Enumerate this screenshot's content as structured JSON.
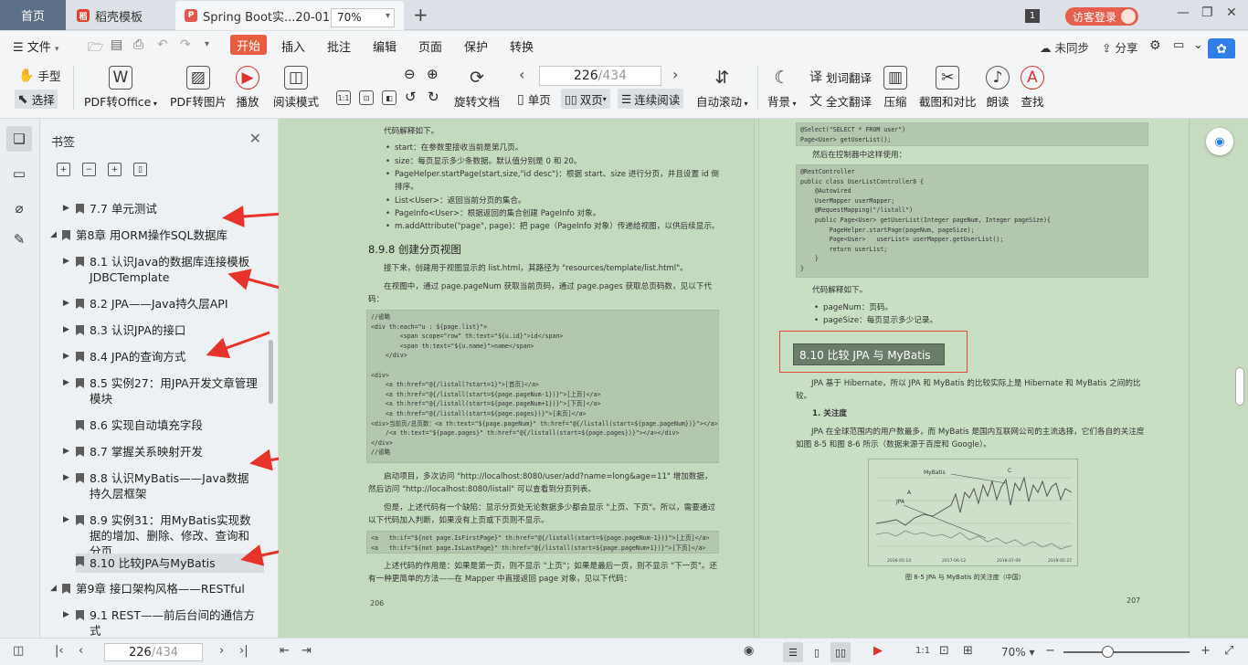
{
  "tabs": {
    "home": "首页",
    "template": "稻壳模板",
    "document": "Spring Boot实...20-01-01.pdf"
  },
  "titlebar": {
    "badge": "1",
    "login": "访客登录"
  },
  "menu": {
    "file": "文件",
    "items": [
      "开始",
      "插入",
      "批注",
      "编辑",
      "页面",
      "保护",
      "转换"
    ],
    "sync": "未同步",
    "share": "分享"
  },
  "toolbar": {
    "hand": "手型",
    "select": "选择",
    "pdf_to_office": "PDF转Office",
    "pdf_to_image": "PDF转图片",
    "play": "播放",
    "read_mode": "阅读模式",
    "zoom": "70%",
    "rotate": "旋转文档",
    "page_current": "226",
    "page_total": "/434",
    "single": "单页",
    "double": "双页",
    "continuous": "连续阅读",
    "auto_scroll": "自动滚动",
    "background": "背景",
    "word_translate": "划词翻译",
    "full_translate": "全文翻译",
    "compress": "压缩",
    "screenshot": "截图和对比",
    "read_aloud": "朗读",
    "find": "查找"
  },
  "bookmarks": {
    "title": "书签",
    "items": [
      "7.7 单元测试",
      "第8章 用ORM操作SQL数据库",
      "8.1 认识Java的数据库连接模板JDBCTemplate",
      "8.2 JPA——Java持久层API",
      "8.3 认识JPA的接口",
      "8.4 JPA的查询方式",
      "8.5 实例27：用JPA开发文章管理模块",
      "8.6 实现自动填充字段",
      "8.7 掌握关系映射开发",
      "8.8 认识MyBatis——Java数据持久层框架",
      "8.9 实例31：用MyBatis实现数据的增加、删除、修改、查询和分页",
      "8.10 比较JPA与MyBatis",
      "第9章 接口架构风格——RESTful",
      "9.1 REST——前后台间的通信方式"
    ]
  },
  "left_page": {
    "intro": "代码解释如下。",
    "bullets": [
      "start：在参数里接收当前是第几页。",
      "size：每页显示多少条数据。默认值分别是 0 和 20。",
      "PageHelper.startPage(start,size,\"id desc\")：根据 start、size 进行分页，并且设置 id 倒排序。",
      "List<User>：返回当前分页的集合。",
      "PageInfo<User>：根据返回的集合创建 PageInfo 对象。",
      "m.addAttribute(\"page\", page)：把 page（PageInfo 对象）传递给视图，以供后续显示。"
    ],
    "heading": "8.9.8   创建分页视图",
    "para1": "接下来，创建用于视图显示的 list.html，其路径为 \"resources/template/list.html\"。",
    "para2": "在视图中，通过 page.pageNum 获取当前页码，通过 page.pages 获取总页码数，见以下代码：",
    "code1": "//省略\n<div th:each=\"u : ${page.list}\">\n        <span scope=\"row\" th:text=\"${u.id}\">id</span>\n        <span th:text=\"${u.name}\">name</span>\n    </div>\n\n<div>\n    <a th:href=\"@{/listall?start=1}\">[首页]</a>\n    <a th:href=\"@{/listall(start=${page.pageNum-1})}\">[上页]</a>\n    <a th:href=\"@{/listall(start=${page.pageNum+1})}\">[下页]</a>\n    <a th:href=\"@{/listall(start=${page.pages})}\">[末页]</a>\n<div>当前页/总页数：<a th:text=\"${page.pageNum}\" th:href=\"@{/listall(start=${page.pageNum})}\"></a>\n    /<a th:text=\"${page.pages}\" th:href=\"@{/listall(start=${page.pages})}\"></a></div>\n</div>\n//省略",
    "para3": "启动项目，多次访问 \"http://localhost:8080/user/add?name=long&age=11\" 增加数据，然后访问 \"http://localhost:8080/listall\" 可以查看到分页列表。",
    "para4": "但是，上述代码有一个缺陷：显示分页处无论数据多少都会显示 \"上页、下页\"。所以，需要通过以下代码加入判断，如果没有上页或下页则不显示。",
    "code2": "<a   th:if=\"${not page.IsFirstPage}\" th:href=\"@{/listall(start=${page.pageNum-1})}\">[上页]</a>\n<a   th:if=\"${not page.IsLastPage}\" th:href=\"@{/listall(start=${page.pageNum+1})}\">[下页]</a>",
    "para5": "上述代码的作用是：如果是第一页，则不显示 \"上页\"；如果是最后一页，则不显示 \"下一页\"。还有一种更简单的方法——在 Mapper 中直接返回 page 对象，见以下代码：",
    "page_number": "206"
  },
  "right_page": {
    "code1": "@Select(\"SELECT * FROM user\")\nPage<User> getUserList();",
    "para1": "然后在控制器中这样使用：",
    "code2": "@RestController\npublic class UserListController8 {\n    @Autowired\n    UserMapper userMapper;\n    @RequestMapping(\"/listall\")\n    public Page<User> getUserList(Integer pageNum, Integer pageSize){\n        PageHelper.startPage(pageNum, pageSize);\n        Page<User>   userList= userMapper.getUserList();\n        return userList;\n    }\n}",
    "para2": "代码解释如下。",
    "bullets": [
      "pageNum：页码。",
      "pageSize：每页显示多少记录。"
    ],
    "section": "8.10   比较 JPA 与 MyBatis",
    "para3": "JPA 基于 Hibernate，所以 JPA 和 MyBatis 的比较实际上是 Hibernate 和 MyBatis 之间的比较。",
    "sub": "1. 关注度",
    "para4": "JPA 在全球范围内的用户数最多，而 MyBatis 是国内互联网公司的主流选择，它们各自的关注度如图 8-5 和图 8-6 所示（数据来源于百度和 Google）。",
    "chart_labels": {
      "mybatis": "MyBatis",
      "jpa": "JPA",
      "c": "C",
      "a": "A"
    },
    "chart_x": [
      "2016-05-14",
      "2017-06-12",
      "2018-07-09",
      "2019-05-27"
    ],
    "figure_caption": "图 8-5   JPA 与 MyBatis 的关注度（中国）",
    "page_number": "207"
  },
  "status": {
    "page_current": "226",
    "page_total": "/434",
    "zoom": "70%"
  }
}
